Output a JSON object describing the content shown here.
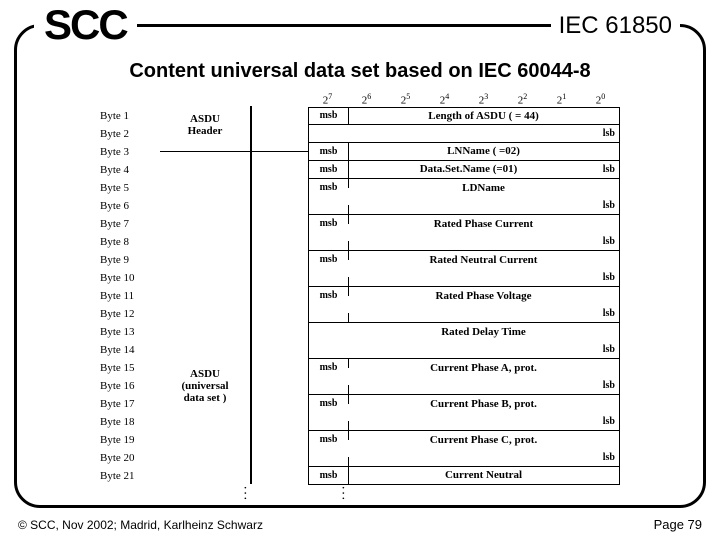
{
  "header": {
    "logo": "SCC",
    "iec": "IEC 61850",
    "title": "Content universal data set based on IEC 60044-8"
  },
  "footer": {
    "copyright": "© SCC, Nov 2002; Madrid, Karlheinz Schwarz",
    "page": "Page 79"
  },
  "bits": [
    "2",
    "2",
    "2",
    "2",
    "2",
    "2",
    "2",
    "2"
  ],
  "bit_powers": [
    "7",
    "6",
    "5",
    "4",
    "3",
    "2",
    "1",
    "0"
  ],
  "sections": {
    "asdu_header": "ASDU\nHeader",
    "asdu_universal": "ASDU\n(universal\ndata set )"
  },
  "bytes": [
    {
      "n": "Byte 1"
    },
    {
      "n": "Byte 2"
    },
    {
      "n": "Byte 3"
    },
    {
      "n": "Byte 4"
    },
    {
      "n": "Byte 5"
    },
    {
      "n": "Byte 6"
    },
    {
      "n": "Byte 7"
    },
    {
      "n": "Byte 8"
    },
    {
      "n": "Byte 9"
    },
    {
      "n": "Byte 10"
    },
    {
      "n": "Byte 11"
    },
    {
      "n": "Byte 12"
    },
    {
      "n": "Byte 13"
    },
    {
      "n": "Byte 14"
    },
    {
      "n": "Byte 15"
    },
    {
      "n": "Byte 16"
    },
    {
      "n": "Byte 17"
    },
    {
      "n": "Byte 18"
    },
    {
      "n": "Byte 19"
    },
    {
      "n": "Byte 20"
    },
    {
      "n": "Byte 21"
    }
  ],
  "labels": {
    "msb": "msb",
    "lsb": "lsb",
    "length": "Length of ASDU ( = 44)",
    "lnname": "LNName ( =02)",
    "dataset": "Data.Set.Name (=01)",
    "ldname": "LDName",
    "rpc": "Rated Phase Current",
    "rnc": "Rated Neutral Current",
    "rpv": "Rated Phase Voltage",
    "rdt": "Rated Delay Time",
    "cpa": "Current Phase A, prot.",
    "cpb": "Current Phase B, prot.",
    "cpc": "Current Phase C, prot.",
    "cn": "Current Neutral"
  }
}
